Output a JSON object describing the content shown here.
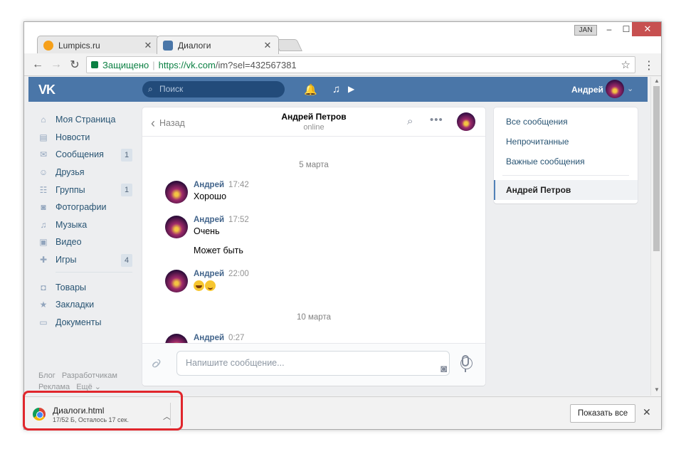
{
  "browser": {
    "tabs": [
      {
        "title": "Lumpics.ru",
        "close": "✕"
      },
      {
        "title": "Диалоги",
        "close": "✕"
      }
    ],
    "profile_badge": "JAN",
    "window_controls": {
      "minimize": "–",
      "maximize": "☐",
      "close": "✕"
    },
    "address": {
      "secure_label": "Защищено",
      "separator": "|",
      "url_host": "https://vk.com",
      "url_path": "/im?sel=432567381"
    },
    "icons": {
      "back": "back-arrow-icon",
      "forward": "forward-arrow-icon",
      "reload": "reload-icon",
      "bookmark": "star-icon",
      "menu": "kebab-menu-icon"
    },
    "glyphs": {
      "back": "←",
      "forward": "→",
      "reload": "↻",
      "star": "☆",
      "menu": "⋮"
    }
  },
  "vk": {
    "logo": "VK",
    "search_placeholder": "Поиск",
    "search_glyph": "⌕",
    "header_glyphs": {
      "bell": "🔔",
      "music": "♫",
      "video": "▶"
    },
    "user_name": "Андрей",
    "user_chevron": "⌄",
    "left_menu": [
      {
        "label": "Моя Страница",
        "icon": "home-icon",
        "glyph": "⌂",
        "badge": ""
      },
      {
        "label": "Новости",
        "icon": "news-icon",
        "glyph": "▤",
        "badge": ""
      },
      {
        "label": "Сообщения",
        "icon": "messages-icon",
        "glyph": "✉",
        "badge": "1"
      },
      {
        "label": "Друзья",
        "icon": "friends-icon",
        "glyph": "☺",
        "badge": ""
      },
      {
        "label": "Группы",
        "icon": "groups-icon",
        "glyph": "☷",
        "badge": "1"
      },
      {
        "label": "Фотографии",
        "icon": "camera-icon",
        "glyph": "◙",
        "badge": ""
      },
      {
        "label": "Музыка",
        "icon": "music-icon",
        "glyph": "♫",
        "badge": ""
      },
      {
        "label": "Видео",
        "icon": "video-icon",
        "glyph": "▣",
        "badge": ""
      },
      {
        "label": "Игры",
        "icon": "gamepad-icon",
        "glyph": "✚",
        "badge": "4"
      }
    ],
    "left_menu_2": [
      {
        "label": "Товары",
        "icon": "shopping-bag-icon",
        "glyph": "◘"
      },
      {
        "label": "Закладки",
        "icon": "bookmark-star-icon",
        "glyph": "★"
      },
      {
        "label": "Документы",
        "icon": "document-icon",
        "glyph": "▭"
      }
    ],
    "footer_links": [
      "Блог",
      "Разработчикам",
      "Реклама",
      "Ещё ⌄"
    ],
    "chat": {
      "back_label": "Назад",
      "back_glyph": "‹",
      "peer_name": "Андрей Петров",
      "peer_status": "online",
      "search_glyph": "⌕",
      "more_glyph": "•••",
      "messages": [
        {
          "type": "date",
          "text": "5 марта"
        },
        {
          "type": "msg",
          "author": "Андрей",
          "time": "17:42",
          "lines": [
            "Хорошо"
          ]
        },
        {
          "type": "msg",
          "author": "Андрей",
          "time": "17:52",
          "lines": [
            "Очень"
          ]
        },
        {
          "type": "cont",
          "text": "Может быть"
        },
        {
          "type": "msg",
          "author": "Андрей",
          "time": "22:00",
          "emoji": [
            "laughing-emoji",
            "smiling-emoji"
          ]
        },
        {
          "type": "date",
          "text": "10 марта"
        },
        {
          "type": "msg",
          "author": "Андрей",
          "time": "0:27",
          "lines": []
        }
      ],
      "composer_placeholder": "Напишите сообщение...",
      "camera_glyph": "◙",
      "clip_glyph": "∂"
    },
    "right_panel": {
      "items": [
        "Все сообщения",
        "Непрочитанные",
        "Важные сообщения"
      ],
      "active": "Андрей Петров"
    }
  },
  "download": {
    "filename": "Диалоги.html",
    "status": "17/52 Б, Осталось 17 сек.",
    "chevron": "︿",
    "show_all": "Показать все",
    "close": "✕"
  },
  "colors": {
    "vk_blue": "#4a76a8",
    "link": "#285473",
    "highlight_red": "#e0262c"
  }
}
